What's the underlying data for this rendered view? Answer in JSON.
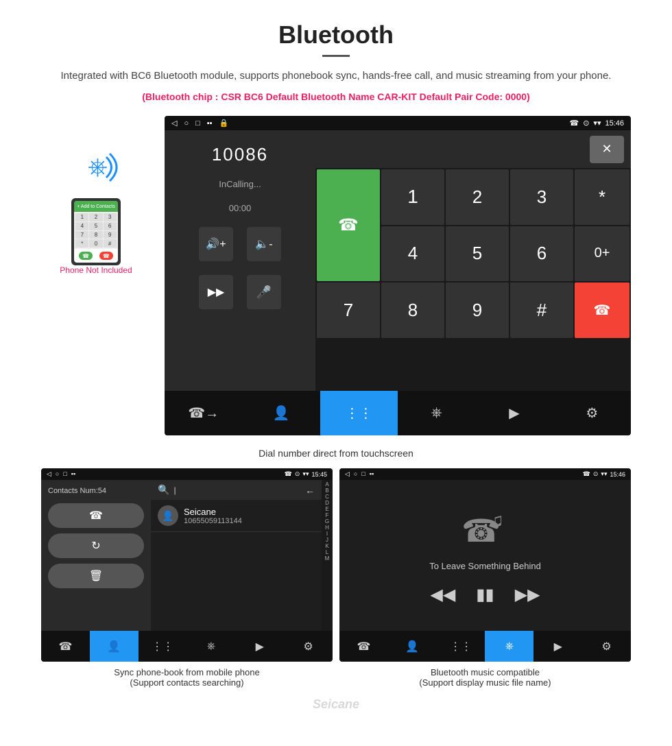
{
  "header": {
    "title": "Bluetooth",
    "description": "Integrated with BC6 Bluetooth module, supports phonebook sync, hands-free call, and music streaming from your phone.",
    "specs": "(Bluetooth chip : CSR BC6    Default Bluetooth Name CAR-KIT    Default Pair Code: 0000)"
  },
  "dial_screen": {
    "status_bar": {
      "time": "15:46",
      "icons_left": [
        "back-icon",
        "home-icon",
        "recents-icon",
        "notification-icon",
        "lock-icon"
      ],
      "icons_right": [
        "call-icon",
        "location-icon",
        "wifi-icon"
      ]
    },
    "phone_number": "10086",
    "calling_label": "InCalling...",
    "timer": "00:00",
    "keys": [
      "1",
      "2",
      "3",
      "*",
      "4",
      "5",
      "6",
      "0+",
      "7",
      "8",
      "9",
      "#"
    ],
    "caption": "Dial number direct from touchscreen",
    "toolbar_items": [
      "call-transfer",
      "contacts",
      "keypad",
      "bluetooth",
      "phone-settings",
      "settings"
    ]
  },
  "phonebook_screen": {
    "status_bar_time": "15:45",
    "contacts_count_label": "Contacts Num:54",
    "search_placeholder": "Search...",
    "contact": {
      "name": "Seicane",
      "number": "10655059113144"
    },
    "alpha_letters": [
      "A",
      "B",
      "C",
      "D",
      "E",
      "F",
      "G",
      "H",
      "I",
      "J",
      "K",
      "L",
      "M"
    ],
    "toolbar_items": [
      "call",
      "contacts",
      "keypad",
      "bluetooth",
      "phone-settings",
      "settings"
    ],
    "caption_line1": "Sync phone-book from mobile phone",
    "caption_line2": "(Support contacts searching)"
  },
  "music_screen": {
    "status_bar_time": "15:46",
    "song_title": "To Leave Something Behind",
    "controls": [
      "previous",
      "play-pause",
      "next"
    ],
    "toolbar_items": [
      "call",
      "contacts",
      "keypad",
      "bluetooth",
      "phone-settings",
      "settings"
    ],
    "caption_line1": "Bluetooth music compatible",
    "caption_line2": "(Support display music file name)"
  },
  "phone_sidebar": {
    "not_included_label": "Phone Not Included"
  },
  "watermark": "Seicane"
}
